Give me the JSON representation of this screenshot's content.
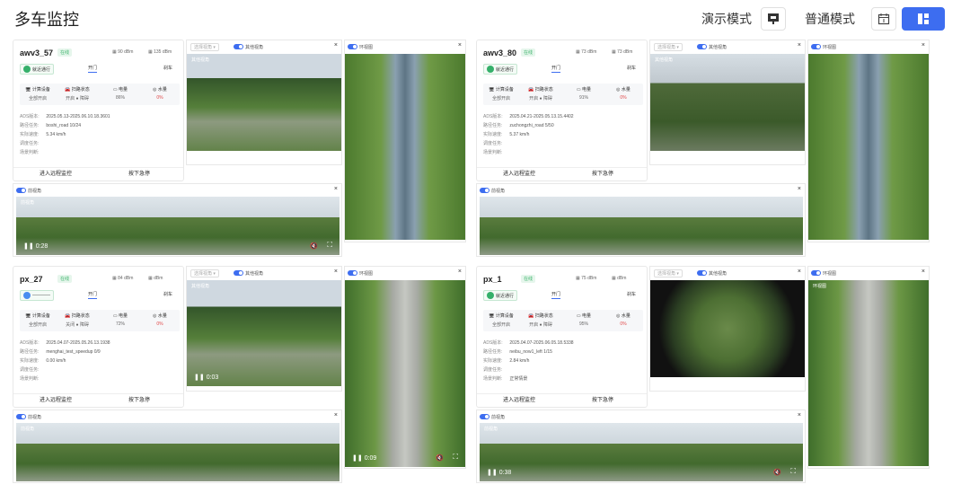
{
  "header": {
    "title": "多车监控",
    "demo_mode": "演示模式",
    "normal_mode": "普通模式"
  },
  "vehicles": [
    {
      "name": "awv3_57",
      "status": "在线",
      "signal1": "90 dBm",
      "signal2": "135 dBm",
      "ctl_label": "就近通行",
      "door": "开门",
      "brake": "刹车",
      "stats": [
        {
          "label": "计算设备",
          "value": "全部开启"
        },
        {
          "label": "扫路状态",
          "value": "开启 ● 障碍"
        },
        {
          "label": "电量",
          "value": "86%"
        },
        {
          "label": "水量",
          "value": "0%"
        }
      ],
      "info": [
        {
          "k": "ADS版本:",
          "v": "2025.05.13-2025.06.10.18.3601"
        },
        {
          "k": "路径任务:",
          "v": "boshi_road 10/24"
        },
        {
          "k": "实际速度:",
          "v": "5.34 km/h"
        },
        {
          "k": "调度任务:",
          "v": ""
        },
        {
          "k": "场景判断:",
          "v": ""
        }
      ],
      "action1": "进入远程监控",
      "action2": "按下急停",
      "front_label": "其他视角",
      "front_tag": "其他视角",
      "bev_label": "环视图",
      "rear_label": "前视角",
      "rear_tag": "前视角",
      "rear_time": "0:28"
    },
    {
      "name": "awv3_80",
      "status": "在线",
      "signal1": "73 dBm",
      "signal2": "73 dBm",
      "ctl_label": "就近通行",
      "door": "开门",
      "brake": "刹车",
      "stats": [
        {
          "label": "计算设备",
          "value": "全部开启"
        },
        {
          "label": "扫路状态",
          "value": "开启 ● 障碍"
        },
        {
          "label": "电量",
          "value": "91%"
        },
        {
          "label": "水量",
          "value": "0%"
        }
      ],
      "info": [
        {
          "k": "ADS版本:",
          "v": "2025.04.21-2025.05.13.15.4402"
        },
        {
          "k": "路径任务:",
          "v": "zuchongzhi_road 5/50"
        },
        {
          "k": "实际速度:",
          "v": "5.37 km/h"
        },
        {
          "k": "调度任务:",
          "v": ""
        },
        {
          "k": "场景判断:",
          "v": ""
        }
      ],
      "action1": "进入远程监控",
      "action2": "按下急停",
      "front_label": "其他视角",
      "front_tag": "其他视角",
      "bev_label": "环视图",
      "rear_label": "前视角",
      "rear_tag": "",
      "rear_time": ""
    },
    {
      "name": "px_27",
      "status": "在线",
      "signal1": "84 dBm",
      "signal2": "dBm",
      "ctl_label": "————",
      "door": "开门",
      "brake": "刹车",
      "stats": [
        {
          "label": "计算设备",
          "value": "全部开启"
        },
        {
          "label": "扫路状态",
          "value": "关闭 ● 障碍"
        },
        {
          "label": "电量",
          "value": "72%"
        },
        {
          "label": "水量",
          "value": "0%"
        }
      ],
      "info": [
        {
          "k": "ADS版本:",
          "v": "2025.04.07-2025.05.26.13.1938"
        },
        {
          "k": "路径任务:",
          "v": "menghai_test_speedup 0/9"
        },
        {
          "k": "实际速度:",
          "v": "0.00 km/h"
        },
        {
          "k": "调度任务:",
          "v": ""
        },
        {
          "k": "场景判断:",
          "v": ""
        }
      ],
      "action1": "进入远程监控",
      "action2": "按下急停",
      "front_label": "其他视角",
      "front_tag": "其他视角",
      "front_time": "0:03",
      "bev_label": "环视图",
      "bev_time": "0:09",
      "rear_label": "前视角",
      "rear_tag": "前视角",
      "rear_time": ""
    },
    {
      "name": "px_1",
      "status": "在线",
      "signal1": "75 dBm",
      "signal2": "dBm",
      "ctl_label": "就近通行",
      "door": "开门",
      "brake": "刹车",
      "stats": [
        {
          "label": "计算设备",
          "value": "全部开启"
        },
        {
          "label": "扫路状态",
          "value": "开启 ● 障碍"
        },
        {
          "label": "电量",
          "value": "95%"
        },
        {
          "label": "水量",
          "value": "0%"
        }
      ],
      "info": [
        {
          "k": "ADS版本:",
          "v": "2025.04.07-2025.06.05.18.5338"
        },
        {
          "k": "路径任务:",
          "v": "neibu_now1_left 1/15"
        },
        {
          "k": "实际速度:",
          "v": "2.84 km/h"
        },
        {
          "k": "调度任务:",
          "v": ""
        },
        {
          "k": "场景判断:",
          "v": "正常情景"
        }
      ],
      "action1": "进入远程监控",
      "action2": "按下急停",
      "front_label": "其他视角",
      "front_tag": "",
      "bev_label": "环视图",
      "bev_tag": "环视图",
      "rear_label": "前视角",
      "rear_tag": "前视角",
      "rear_time": "0:38"
    }
  ],
  "colors": {
    "accent": "#3d6df0",
    "online": "#3bb36a",
    "alert": "#e04848"
  }
}
